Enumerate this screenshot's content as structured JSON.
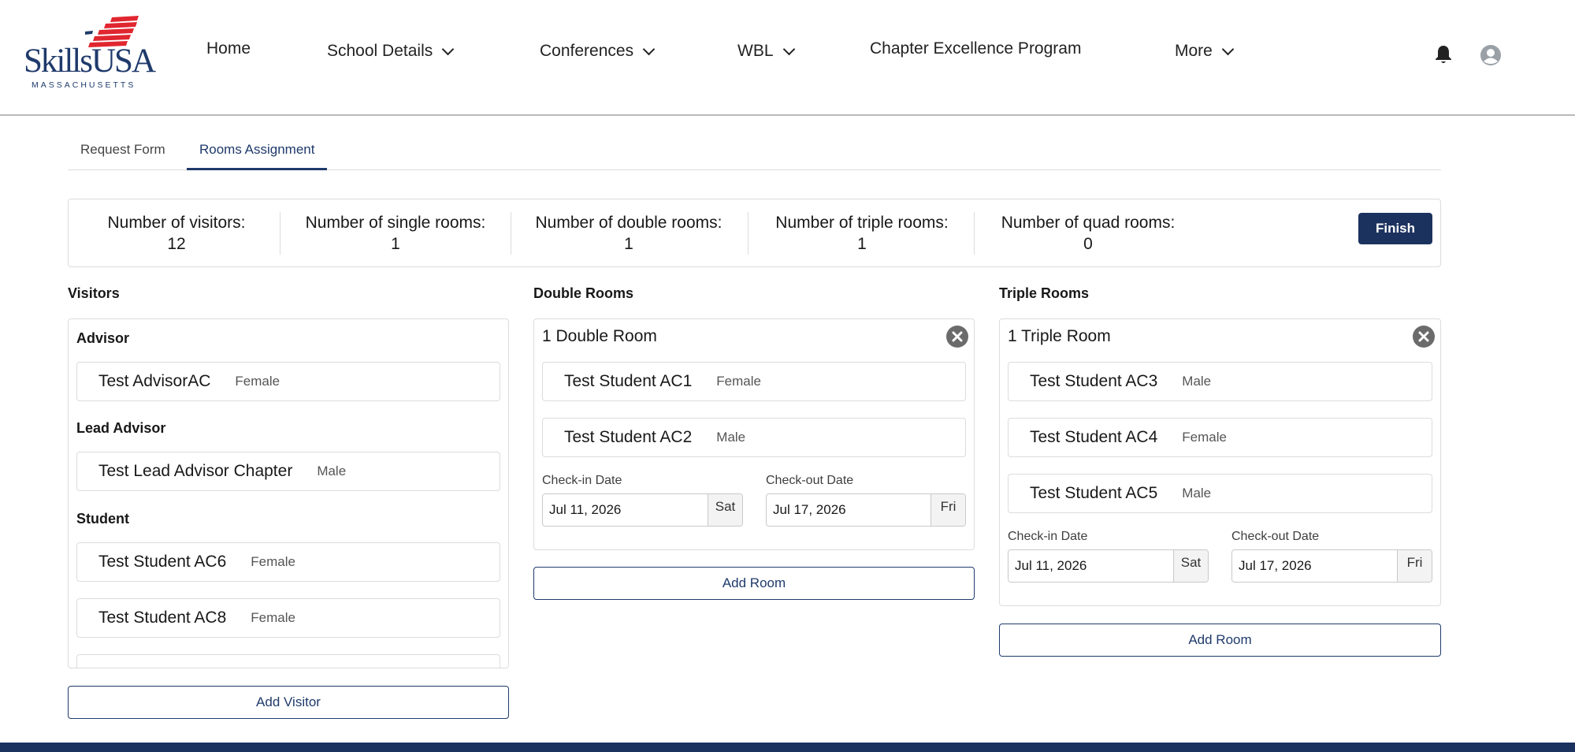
{
  "header": {
    "logo": {
      "word": "SkillsUSA",
      "sub": "MASSACHUSETTS",
      "flag_color": "#e0262f",
      "brand_color": "#1f3a6b"
    },
    "nav": [
      {
        "label": "Home",
        "has_menu": false
      },
      {
        "label": "School Details",
        "has_menu": true
      },
      {
        "label": "Conferences",
        "has_menu": true
      },
      {
        "label": "WBL",
        "has_menu": true
      },
      {
        "label": "Chapter Excellence Program",
        "has_menu": false
      },
      {
        "label": "More",
        "has_menu": true
      }
    ],
    "icons": [
      "bell-icon",
      "user-avatar-icon"
    ]
  },
  "tabs": [
    {
      "label": "Request Form",
      "active": false
    },
    {
      "label": "Rooms Assignment",
      "active": true
    }
  ],
  "stats": [
    {
      "label": "Number of visitors:",
      "value": "12"
    },
    {
      "label": "Number of single rooms:",
      "value": "1"
    },
    {
      "label": "Number of double rooms:",
      "value": "1"
    },
    {
      "label": "Number of triple rooms:",
      "value": "1"
    },
    {
      "label": "Number of quad rooms:",
      "value": "0"
    }
  ],
  "finish_label": "Finish",
  "visitors": {
    "title": "Visitors",
    "groups": [
      {
        "label": "Advisor",
        "people": [
          {
            "name": "Test AdvisorAC",
            "gender": "Female"
          }
        ]
      },
      {
        "label": "Lead Advisor",
        "people": [
          {
            "name": "Test Lead Advisor Chapter",
            "gender": "Male"
          }
        ]
      },
      {
        "label": "Student",
        "people": [
          {
            "name": "Test Student AC6",
            "gender": "Female"
          },
          {
            "name": "Test Student AC8",
            "gender": "Female"
          }
        ]
      }
    ],
    "add_label": "Add Visitor"
  },
  "double_rooms": {
    "title": "Double Rooms",
    "room": {
      "title": "1 Double Room",
      "people": [
        {
          "name": "Test Student AC1",
          "gender": "Female"
        },
        {
          "name": "Test Student AC2",
          "gender": "Male"
        }
      ],
      "checkin_label": "Check-in Date",
      "checkin_value": "Jul 11, 2026",
      "checkin_day": "Sat",
      "checkout_label": "Check-out Date",
      "checkout_value": "Jul 17, 2026",
      "checkout_day": "Fri"
    },
    "add_label": "Add Room"
  },
  "triple_rooms": {
    "title": "Triple Rooms",
    "room": {
      "title": "1 Triple Room",
      "people": [
        {
          "name": "Test Student AC3",
          "gender": "Male"
        },
        {
          "name": "Test Student AC4",
          "gender": "Female"
        },
        {
          "name": "Test Student AC5",
          "gender": "Male"
        }
      ],
      "checkin_label": "Check-in Date",
      "checkin_value": "Jul 11, 2026",
      "checkin_day": "Sat",
      "checkout_label": "Check-out Date",
      "checkout_value": "Jul 17, 2026",
      "checkout_day": "Fri"
    },
    "add_label": "Add Room"
  },
  "colors": {
    "primary": "#1c325e",
    "border": "#dcdcdc",
    "close_icon": "#6b6b6b"
  }
}
